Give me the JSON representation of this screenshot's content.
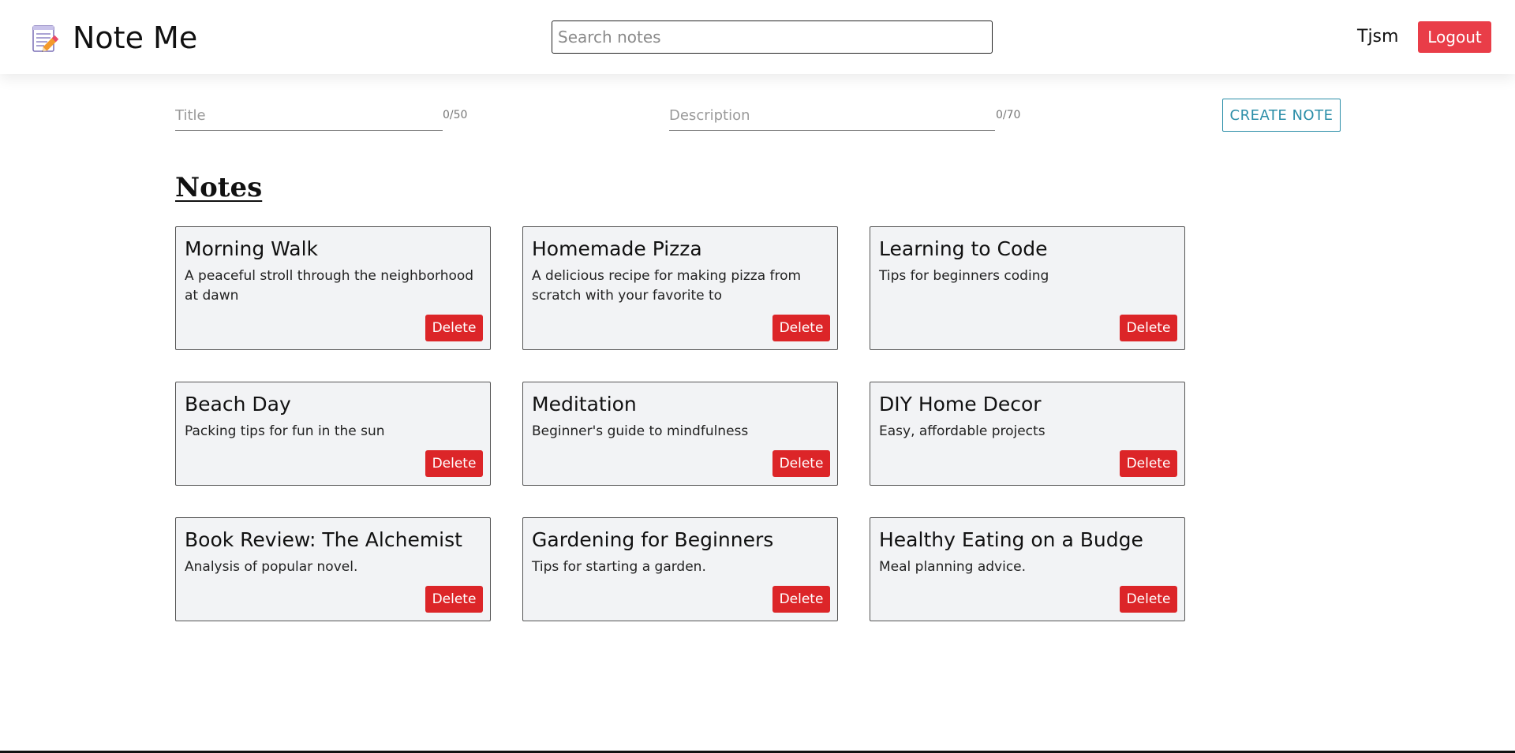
{
  "header": {
    "app_name": "Note Me",
    "search_placeholder": "Search notes",
    "username": "Tjsm",
    "logout_label": "Logout"
  },
  "create_form": {
    "title_placeholder": "Title",
    "title_counter": "0/50",
    "description_placeholder": "Description",
    "description_counter": "0/70",
    "create_label": "CREATE NOTE"
  },
  "notes": {
    "heading": "Notes",
    "delete_label": "Delete",
    "items": [
      {
        "title": "Morning Walk",
        "description": "A peaceful stroll through the neighborhood at dawn"
      },
      {
        "title": "Homemade Pizza",
        "description": "A delicious recipe for making pizza from scratch with your favorite to"
      },
      {
        "title": "Learning to Code",
        "description": "Tips for beginners coding"
      },
      {
        "title": "Beach Day",
        "description": "Packing tips for fun in the sun"
      },
      {
        "title": "Meditation",
        "description": "Beginner's guide to mindfulness"
      },
      {
        "title": "DIY Home Decor",
        "description": "Easy, affordable projects"
      },
      {
        "title": "Book Review: The Alchemist",
        "description": "Analysis of popular novel."
      },
      {
        "title": "Gardening for Beginners",
        "description": "Tips for starting a garden."
      },
      {
        "title": "Healthy Eating on a Budge",
        "description": "Meal planning advice."
      }
    ]
  },
  "colors": {
    "logout_bg": "#e93d48",
    "delete_bg": "#dc2528",
    "create_accent": "#2b8ea8",
    "card_bg": "#f2f3f5"
  },
  "icons": {
    "brand": "memo-pencil-icon"
  }
}
